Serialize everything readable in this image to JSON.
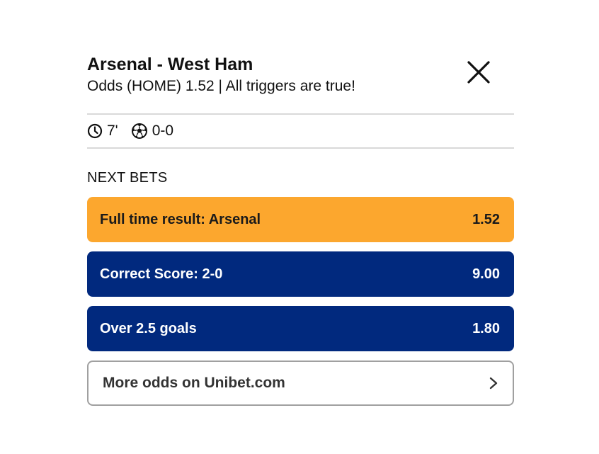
{
  "match": {
    "title": "Arsenal - West Ham",
    "subtitle": "Odds (HOME) 1.52 | All triggers are true!"
  },
  "status": {
    "time": "7'",
    "score": "0-0",
    "time_icon": "clock-icon",
    "score_icon": "soccer-ball-icon"
  },
  "section": {
    "label": "NEXT BETS"
  },
  "bets": [
    {
      "label": "Full time result: Arsenal",
      "odds": "1.52",
      "style": "highlight"
    },
    {
      "label": "Correct Score: 2-0",
      "odds": "9.00",
      "style": "normal"
    },
    {
      "label": "Over 2.5 goals",
      "odds": "1.80",
      "style": "normal"
    }
  ],
  "more": {
    "label": "More odds on Unibet.com",
    "icon": "chevron-right-icon"
  },
  "colors": {
    "highlight": "#fca72e",
    "primary": "#01297e",
    "divider": "#d9d9d9"
  }
}
